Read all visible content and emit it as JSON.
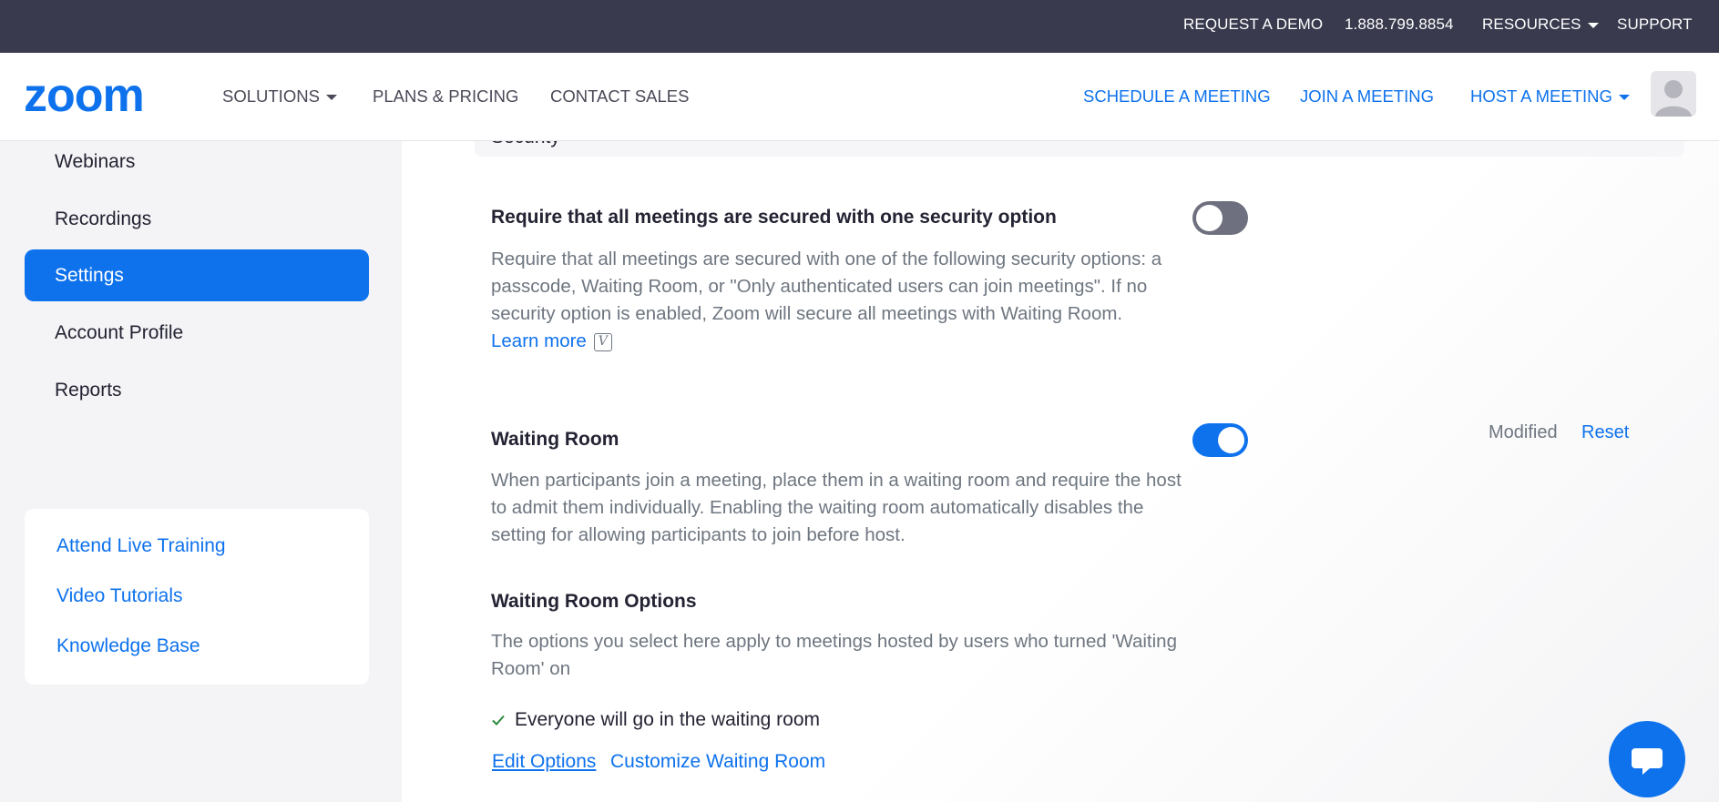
{
  "topbar": {
    "request_demo": "REQUEST A DEMO",
    "phone": "1.888.799.8854",
    "resources": "RESOURCES",
    "support": "SUPPORT"
  },
  "header": {
    "logo_text": "zoom",
    "solutions": "SOLUTIONS",
    "plans_pricing": "PLANS & PRICING",
    "contact_sales": "CONTACT SALES",
    "schedule_meeting": "SCHEDULE A MEETING",
    "join_meeting": "JOIN A MEETING",
    "host_meeting": "HOST A MEETING"
  },
  "sidebar": {
    "items": [
      {
        "label": "Webinars",
        "active": false
      },
      {
        "label": "Recordings",
        "active": false
      },
      {
        "label": "Settings",
        "active": true
      },
      {
        "label": "Account Profile",
        "active": false
      },
      {
        "label": "Reports",
        "active": false
      }
    ],
    "help_links": [
      "Attend Live Training",
      "Video Tutorials",
      "Knowledge Base"
    ]
  },
  "main": {
    "section_header": "Security",
    "secure_option": {
      "title": "Require that all meetings are secured with one security option",
      "description": "Require that all meetings are secured with one of the following security options: a passcode, Waiting Room, or \"Only authenticated users can join meetings\". If no security option is enabled, Zoom will secure all meetings with Waiting Room.",
      "learn_more": "Learn more",
      "v_icon_text": "V",
      "enabled": false
    },
    "waiting_room": {
      "title": "Waiting Room",
      "description": "When participants join a meeting, place them in a waiting room and require the host to admit them individually. Enabling the waiting room automatically disables the setting for allowing participants to join before host.",
      "enabled": true,
      "modified_label": "Modified",
      "reset_label": "Reset"
    },
    "waiting_room_options": {
      "title": "Waiting Room Options",
      "description": "The options you select here apply to meetings hosted by users who turned 'Waiting Room' on",
      "selected_option": "Everyone will go in the waiting room",
      "edit_options": "Edit Options",
      "customize": "Customize Waiting Room"
    }
  },
  "colors": {
    "brand_blue": "#0e72ed",
    "topbar_bg": "#393a4e",
    "toggle_off": "#6e7080",
    "check_green": "#2a8a3a"
  },
  "icons": [
    "zoom-logo",
    "caret-down-icon",
    "avatar-icon",
    "v-badge-icon",
    "check-icon",
    "chat-bubble-icon"
  ]
}
